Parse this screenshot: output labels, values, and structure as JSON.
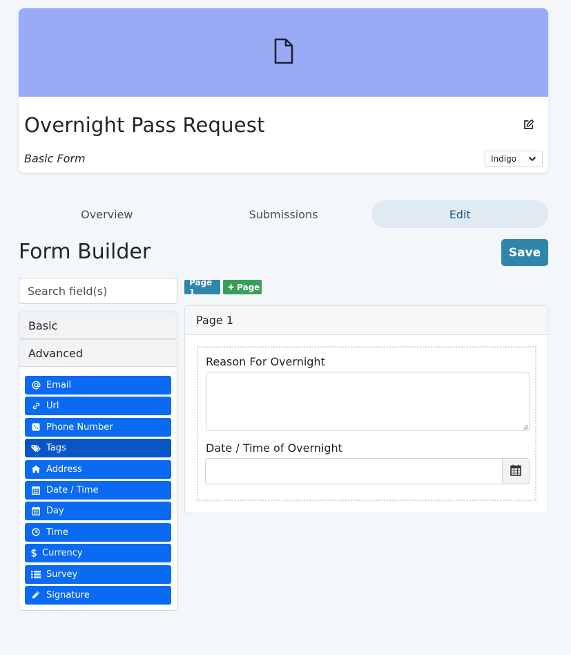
{
  "form": {
    "title": "Overnight Pass Request",
    "subtitle": "Basic Form",
    "theme_selected": "Indigo",
    "banner_icon": "file-icon",
    "banner_color": "#99aaf7"
  },
  "tabs": [
    {
      "label": "Overview"
    },
    {
      "label": "Submissions"
    },
    {
      "label": "Edit",
      "active": true
    }
  ],
  "builder": {
    "title": "Form Builder",
    "save_label": "Save",
    "search_placeholder": "Search field(s)",
    "groups": {
      "basic": "Basic",
      "advanced": "Advanced"
    },
    "advanced_fields": [
      {
        "label": "Email",
        "icon": "at-icon"
      },
      {
        "label": "Url",
        "icon": "link-icon"
      },
      {
        "label": "Phone Number",
        "icon": "phone-icon"
      },
      {
        "label": "Tags",
        "icon": "tags-icon"
      },
      {
        "label": "Address",
        "icon": "home-icon"
      },
      {
        "label": "Date / Time",
        "icon": "calendar-icon"
      },
      {
        "label": "Day",
        "icon": "calendar-icon"
      },
      {
        "label": "Time",
        "icon": "clock-icon"
      },
      {
        "label": "Currency",
        "icon": "dollar-icon"
      },
      {
        "label": "Survey",
        "icon": "list-icon"
      },
      {
        "label": "Signature",
        "icon": "pencil-icon"
      }
    ]
  },
  "pages": {
    "page1_badge": "Page 1",
    "add_page_badge": "Page",
    "panel_title": "Page 1",
    "fields": [
      {
        "label": "Reason For Overnight",
        "type": "textarea"
      },
      {
        "label": "Date / Time of Overnight",
        "type": "datetime"
      }
    ]
  },
  "colors": {
    "accent": "#2e86ab",
    "field_button": "#0a6af2",
    "add_page": "#3a9e5b"
  }
}
